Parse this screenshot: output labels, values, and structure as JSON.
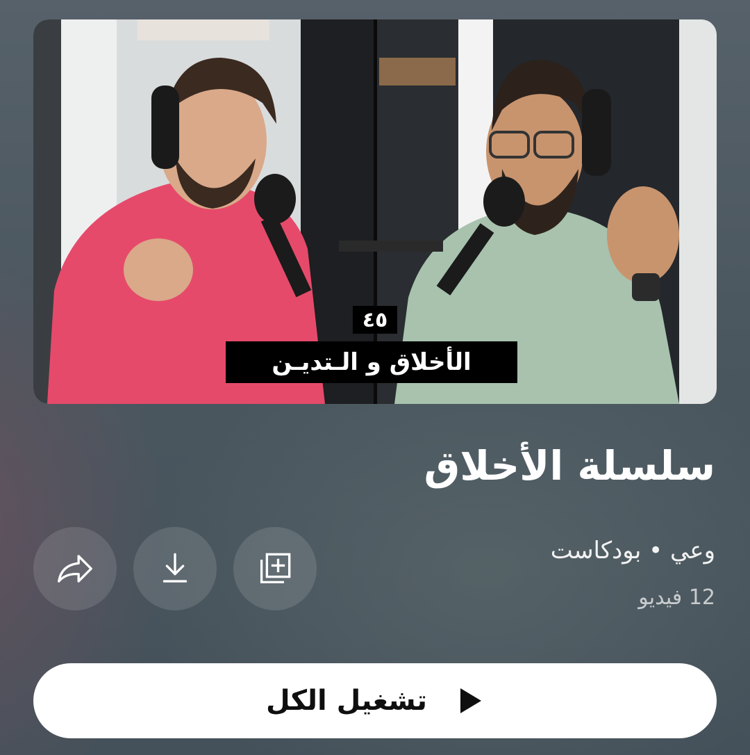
{
  "thumbnail": {
    "episode_number": "٤٥",
    "episode_title": "الأخلاق و الـتديـن"
  },
  "playlist": {
    "title": "سلسلة الأخلاق",
    "channel_line": "وعي • بودكاست",
    "video_count": "12 فيديو"
  },
  "actions": {
    "share_icon": "share-icon",
    "download_icon": "download-icon",
    "save_icon": "add-to-library-icon"
  },
  "play_all": {
    "label": "تشغيل الكل",
    "icon": "play-icon"
  },
  "colors": {
    "background": "#4d5961",
    "button_bg": "#ffffff",
    "button_text": "#0f0f0f"
  }
}
